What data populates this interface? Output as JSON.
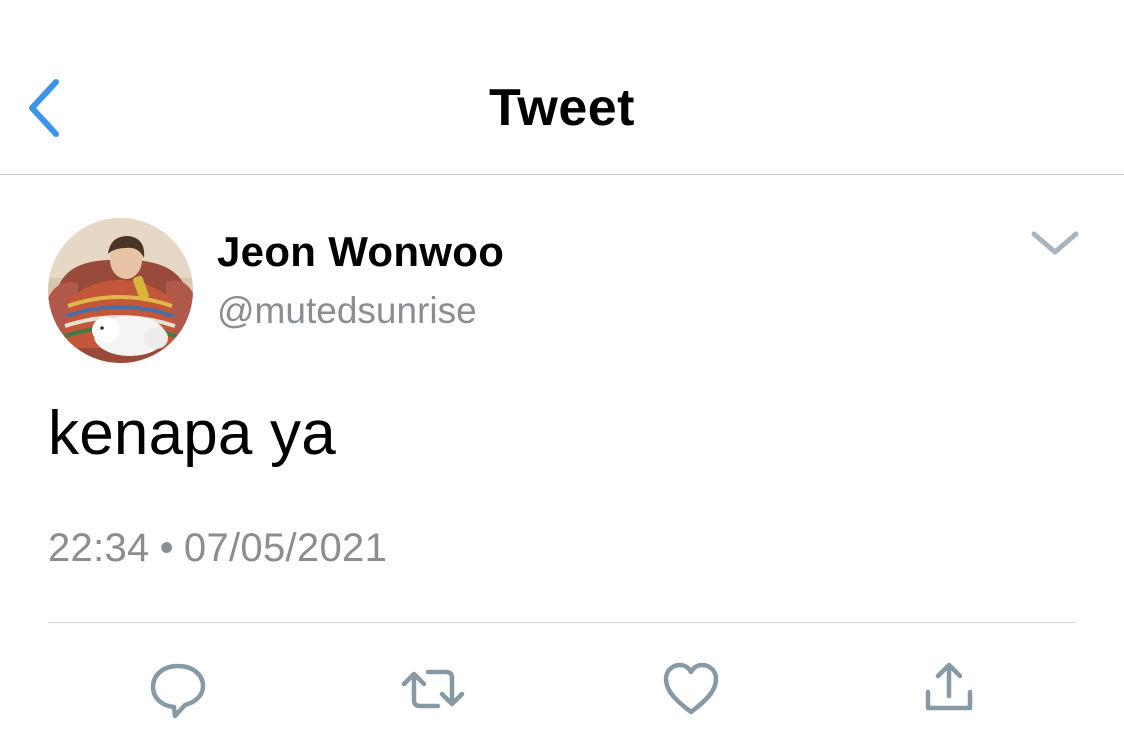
{
  "colors": {
    "accent": "#1da1f2",
    "secondary_text": "#8a8d91",
    "icon_gray": "#8899a6",
    "divider": "#c8c8cc"
  },
  "header": {
    "title": "Tweet",
    "back_icon": "chevron-left-icon"
  },
  "tweet": {
    "author": {
      "name": "Jeon Wonwoo",
      "handle": "@mutedsunrise",
      "avatar_icon": "avatar"
    },
    "more_icon": "chevron-down-icon",
    "text": "kenapa ya",
    "time": "22:34",
    "separator": "•",
    "date": "07/05/2021"
  },
  "actions": [
    {
      "name": "reply",
      "icon": "reply-icon"
    },
    {
      "name": "retweet",
      "icon": "retweet-icon"
    },
    {
      "name": "like",
      "icon": "heart-icon"
    },
    {
      "name": "share",
      "icon": "share-icon"
    }
  ]
}
